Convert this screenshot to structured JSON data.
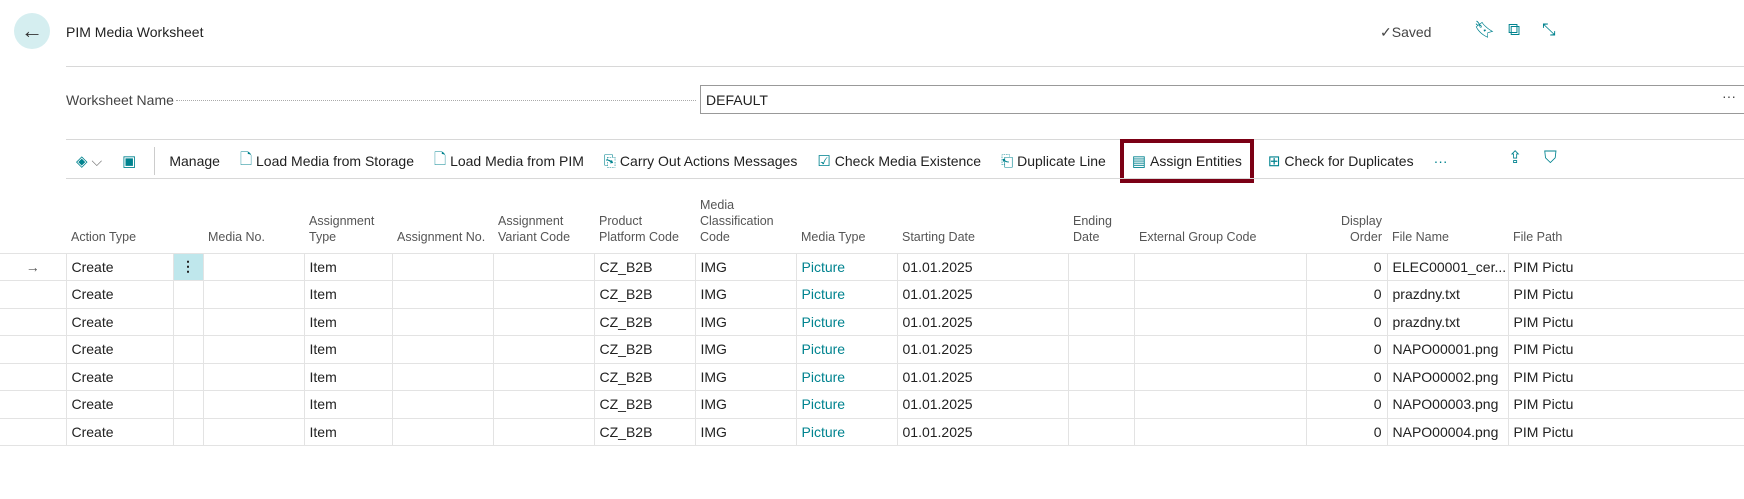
{
  "header": {
    "title": "PIM Media Worksheet",
    "saved": "Saved"
  },
  "worksheet": {
    "label": "Worksheet Name",
    "value": "DEFAULT",
    "more": "···"
  },
  "toolbar": {
    "manage": "Manage",
    "load_storage": "Load Media from Storage",
    "load_pim": "Load Media from PIM",
    "carry_out": "Carry Out Actions Messages",
    "check_existence": "Check Media Existence",
    "duplicate_line": "Duplicate Line",
    "assign_entities": "Assign Entities",
    "check_duplicates": "Check for Duplicates",
    "more": "···"
  },
  "columns": [
    "Action Type",
    "",
    "Media No.",
    "Assignment Type",
    "Assignment No.",
    "Assignment Variant Code",
    "Product Platform Code",
    "Media Classification Code",
    "Media Type",
    "Starting Date",
    "Ending Date",
    "External Group Code",
    "Display Order",
    "File Name",
    "File Path"
  ],
  "rows": [
    [
      "Create",
      "",
      "",
      "Item",
      "",
      "",
      "CZ_B2B",
      "IMG",
      "Picture",
      "01.01.2025",
      "",
      "",
      "0",
      "ELEC00001_cer...",
      "PIM Pictu"
    ],
    [
      "Create",
      "",
      "",
      "Item",
      "",
      "",
      "CZ_B2B",
      "IMG",
      "Picture",
      "01.01.2025",
      "",
      "",
      "0",
      "prazdny.txt",
      "PIM Pictu"
    ],
    [
      "Create",
      "",
      "",
      "Item",
      "",
      "",
      "CZ_B2B",
      "IMG",
      "Picture",
      "01.01.2025",
      "",
      "",
      "0",
      "prazdny.txt",
      "PIM Pictu"
    ],
    [
      "Create",
      "",
      "",
      "Item",
      "",
      "",
      "CZ_B2B",
      "IMG",
      "Picture",
      "01.01.2025",
      "",
      "",
      "0",
      "NAPO00001.png",
      "PIM Pictu"
    ],
    [
      "Create",
      "",
      "",
      "Item",
      "",
      "",
      "CZ_B2B",
      "IMG",
      "Picture",
      "01.01.2025",
      "",
      "",
      "0",
      "NAPO00002.png",
      "PIM Pictu"
    ],
    [
      "Create",
      "",
      "",
      "Item",
      "",
      "",
      "CZ_B2B",
      "IMG",
      "Picture",
      "01.01.2025",
      "",
      "",
      "0",
      "NAPO00003.png",
      "PIM Pictu"
    ],
    [
      "Create",
      "",
      "",
      "Item",
      "",
      "",
      "CZ_B2B",
      "IMG",
      "Picture",
      "01.01.2025",
      "",
      "",
      "0",
      "NAPO00004.png",
      "PIM Pictu"
    ]
  ]
}
